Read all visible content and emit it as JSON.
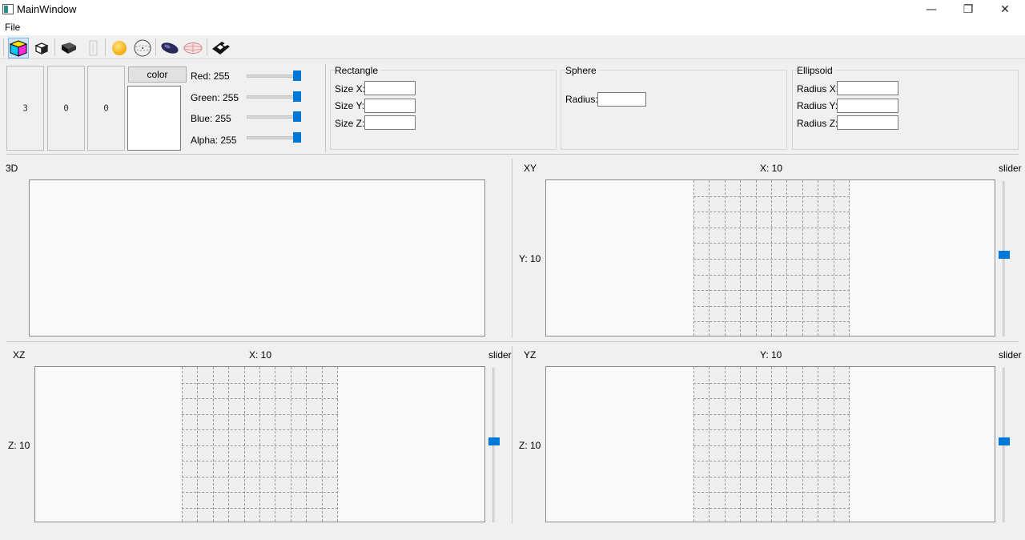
{
  "window": {
    "title": "MainWindow",
    "minimize": "—",
    "restore": "❐",
    "close": "✕"
  },
  "menu": {
    "file": "File"
  },
  "toolbar": {
    "tools": [
      "cube-color-icon",
      "cube-icon",
      "box-dark-icon",
      "box-outline-icon",
      "sphere-icon",
      "sphere-outline-icon",
      "ellipsoid-icon",
      "ellipsoid-outline-icon",
      "eraser-icon"
    ],
    "active_tool": "cube-color-icon"
  },
  "side_boxes": [
    "3",
    "0",
    "0"
  ],
  "color": {
    "button_label": "color",
    "preview_hex": "#ffffff",
    "channels": [
      {
        "label": "Red: 255",
        "value": 255,
        "max": 255
      },
      {
        "label": "Green: 255",
        "value": 255,
        "max": 255
      },
      {
        "label": "Blue: 255",
        "value": 255,
        "max": 255
      },
      {
        "label": "Alpha: 255",
        "value": 255,
        "max": 255
      }
    ]
  },
  "rectangle": {
    "title": "Rectangle",
    "size_x_label": "Size X:",
    "size_x": "",
    "size_y_label": "Size Y:",
    "size_y": "",
    "size_z_label": "Size Z:",
    "size_z": ""
  },
  "sphere": {
    "title": "Sphere",
    "radius_label": "Radius:",
    "radius": ""
  },
  "ellipsoid": {
    "title": "Ellipsoid",
    "radius_x_label": "Radius X:",
    "radius_x": "",
    "radius_y_label": "Radius Y:",
    "radius_y": "",
    "radius_z_label": "Radius Z:",
    "radius_z": ""
  },
  "views": {
    "view3d": {
      "title": "3D"
    },
    "xy": {
      "title": "XY",
      "axis_top": "X: 10",
      "axis_left": "Y: 10",
      "slider_label": "slider",
      "slider_value": 0.5
    },
    "xz": {
      "title": "XZ",
      "axis_top": "X: 10",
      "axis_left": "Z: 10",
      "slider_label": "slider",
      "slider_value": 0.5
    },
    "yz": {
      "title": "YZ",
      "axis_top": "Y: 10",
      "axis_left": "Z: 10",
      "slider_label": "slider",
      "slider_value": 0.5
    }
  },
  "accent_color": "#0078d7"
}
